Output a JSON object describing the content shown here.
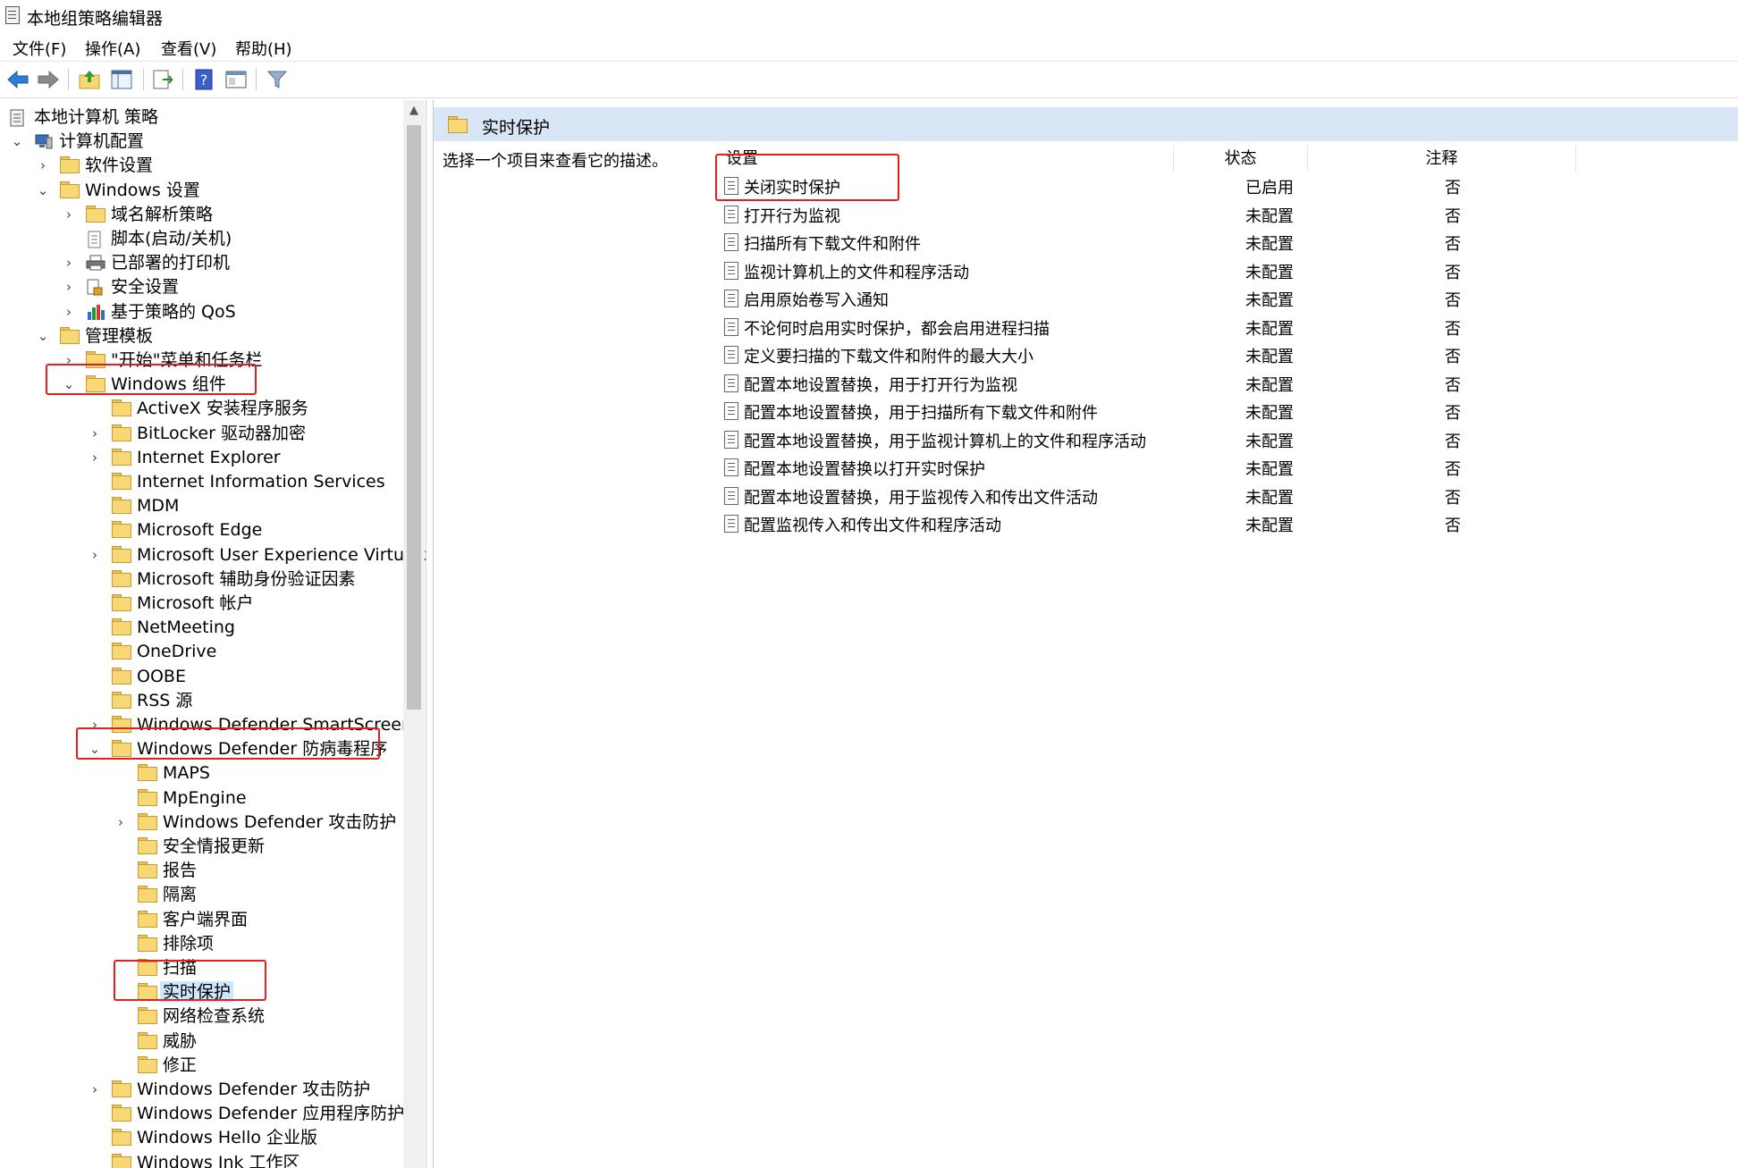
{
  "window": {
    "title": "本地组策略编辑器"
  },
  "menu": [
    "文件(F)",
    "操作(A)",
    "查看(V)",
    "帮助(H)"
  ],
  "toolbar": [
    "back-arrow-icon",
    "forward-arrow-icon",
    "up-folder-icon",
    "show-hide-tree-icon",
    "export-list-icon",
    "help-icon",
    "properties-icon",
    "filter-icon"
  ],
  "tree": {
    "root": "本地计算机 策略",
    "computer_config": "计算机配置",
    "software_settings": "软件设置",
    "windows_settings": "Windows 设置",
    "dns_policy": "域名解析策略",
    "scripts": "脚本(启动/关机)",
    "printers": "已部署的打印机",
    "security_settings": "安全设置",
    "qos": "基于策略的 QoS",
    "admin_templates": "管理模板",
    "start_menu": "\"开始\"菜单和任务栏",
    "windows_components": "Windows 组件",
    "components": [
      "ActiveX 安装程序服务",
      "BitLocker 驱动器加密",
      "Internet Explorer",
      "Internet Information Services",
      "MDM",
      "Microsoft Edge",
      "Microsoft User Experience Virtualizat",
      "Microsoft 辅助身份验证因素",
      "Microsoft 帐户",
      "NetMeeting",
      "OneDrive",
      "OOBE",
      "RSS 源",
      "Windows Defender SmartScreen"
    ],
    "defender_av": "Windows Defender 防病毒程序",
    "defender_children": [
      "MAPS",
      "MpEngine",
      "Windows Defender 攻击防护",
      "安全情报更新",
      "报告",
      "隔离",
      "客户端界面",
      "排除项",
      "扫描",
      "实时保护",
      "网络检查系统",
      "威胁",
      "修正"
    ],
    "after": [
      "Windows Defender 攻击防护",
      "Windows Defender 应用程序防护",
      "Windows Hello 企业版",
      "Windows Ink 工作区"
    ]
  },
  "right": {
    "header": "实时保护",
    "description": "选择一个项目来查看它的描述。",
    "columns": {
      "setting": "设置",
      "state": "状态",
      "note": "注释"
    },
    "rows": [
      {
        "name": "关闭实时保护",
        "state": "已启用",
        "note": "否"
      },
      {
        "name": "打开行为监视",
        "state": "未配置",
        "note": "否"
      },
      {
        "name": "扫描所有下载文件和附件",
        "state": "未配置",
        "note": "否"
      },
      {
        "name": "监视计算机上的文件和程序活动",
        "state": "未配置",
        "note": "否"
      },
      {
        "name": "启用原始卷写入通知",
        "state": "未配置",
        "note": "否"
      },
      {
        "name": "不论何时启用实时保护，都会启用进程扫描",
        "state": "未配置",
        "note": "否"
      },
      {
        "name": "定义要扫描的下载文件和附件的最大大小",
        "state": "未配置",
        "note": "否"
      },
      {
        "name": "配置本地设置替换，用于打开行为监视",
        "state": "未配置",
        "note": "否"
      },
      {
        "name": "配置本地设置替换，用于扫描所有下载文件和附件",
        "state": "未配置",
        "note": "否"
      },
      {
        "name": "配置本地设置替换，用于监视计算机上的文件和程序活动",
        "state": "未配置",
        "note": "否"
      },
      {
        "name": "配置本地设置替换以打开实时保护",
        "state": "未配置",
        "note": "否"
      },
      {
        "name": "配置本地设置替换，用于监视传入和传出文件活动",
        "state": "未配置",
        "note": "否"
      },
      {
        "name": "配置监视传入和传出文件和程序活动",
        "state": "未配置",
        "note": "否"
      }
    ]
  },
  "colors": {
    "highlight": "#e02020",
    "selection": "#cce8ff",
    "header_bg": "#d9e6f5"
  }
}
